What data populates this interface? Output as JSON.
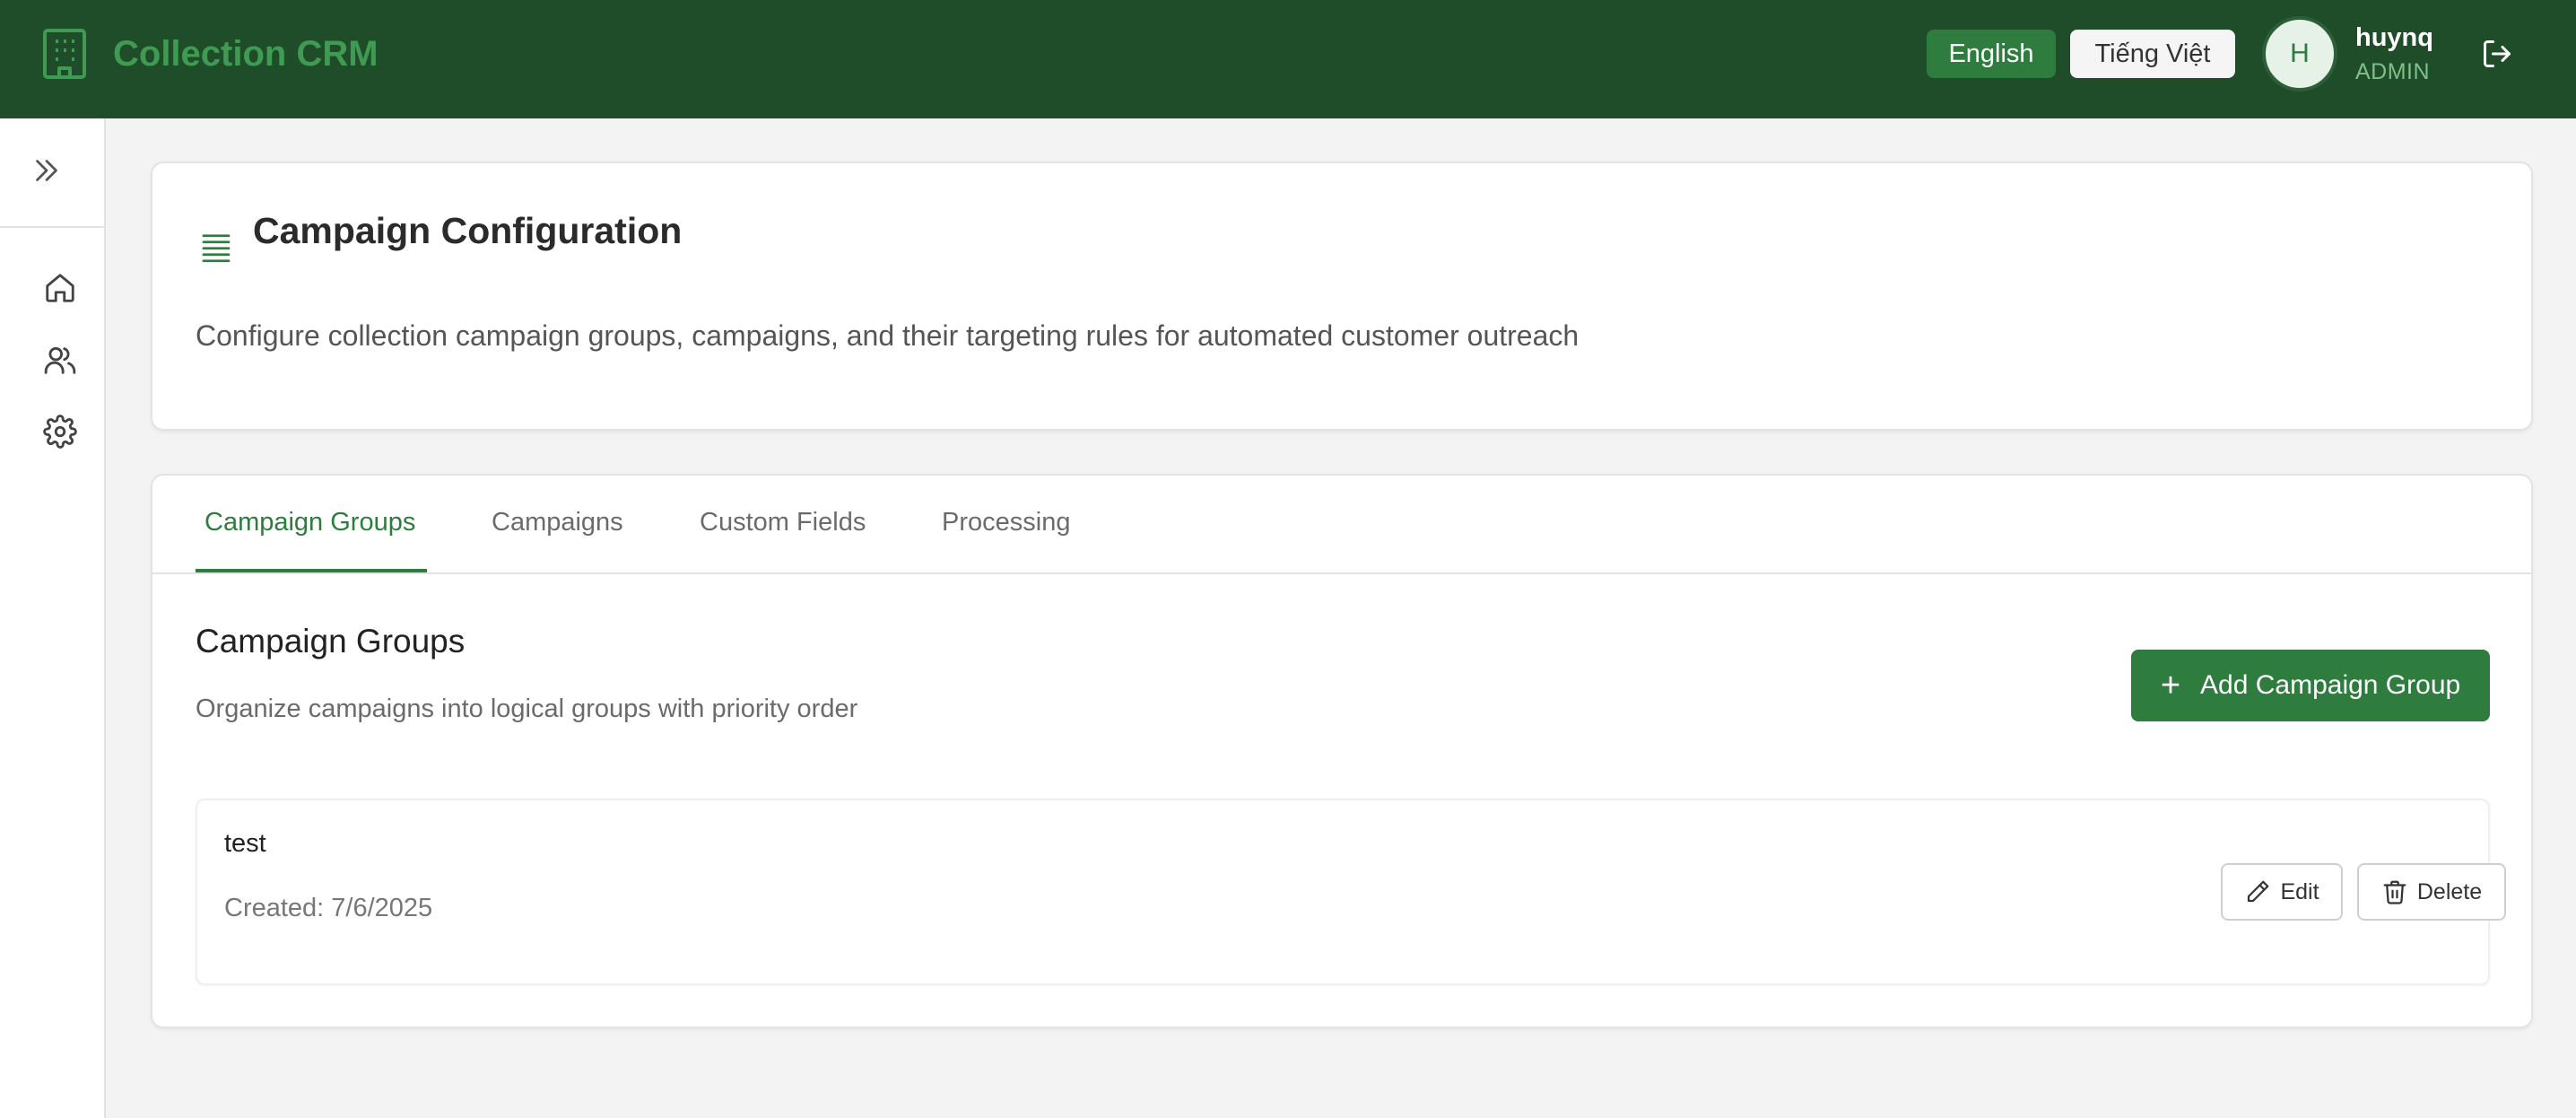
{
  "header": {
    "app_title": "Collection CRM",
    "lang_english": "English",
    "lang_vietnamese": "Tiếng Việt",
    "avatar_initial": "H",
    "user_name": "huynq",
    "user_role": "ADMIN"
  },
  "sidebar": {
    "items": [
      {
        "icon": "home-icon"
      },
      {
        "icon": "users-icon"
      },
      {
        "icon": "gear-icon"
      }
    ]
  },
  "config": {
    "title": "Campaign Configuration",
    "description": "Configure collection campaign groups, campaigns, and their targeting rules for automated customer outreach"
  },
  "tabs": [
    {
      "label": "Campaign Groups",
      "active": true
    },
    {
      "label": "Campaigns",
      "active": false
    },
    {
      "label": "Custom Fields",
      "active": false
    },
    {
      "label": "Processing",
      "active": false
    }
  ],
  "section": {
    "title": "Campaign Groups",
    "description": "Organize campaigns into logical groups with priority order",
    "add_label": "Add Campaign Group"
  },
  "groups": [
    {
      "name": "test",
      "created": "Created: 7/6/2025",
      "edit_label": "Edit",
      "delete_label": "Delete"
    }
  ],
  "colors": {
    "header_bg": "#1f4d2a",
    "accent": "#2e7d3e",
    "brand": "#3f9a52"
  }
}
